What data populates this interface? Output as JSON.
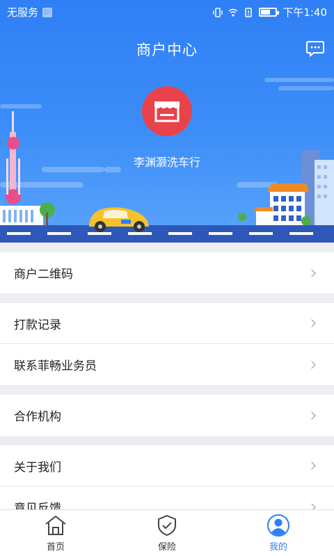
{
  "status_bar": {
    "carrier": "无服务",
    "time": "下午1:40"
  },
  "header": {
    "title": "商户中心",
    "message_icon": "chat-bubble-icon"
  },
  "merchant": {
    "name": "李渊灏洗车行",
    "avatar_icon": "storefront-icon",
    "avatar_color": "#e8434b"
  },
  "menu_groups": [
    [
      {
        "label": "商户二维码"
      }
    ],
    [
      {
        "label": "打款记录"
      },
      {
        "label": "联系菲畅业务员"
      }
    ],
    [
      {
        "label": "合作机构"
      }
    ],
    [
      {
        "label": "关于我们"
      },
      {
        "label": "意见反馈"
      }
    ]
  ],
  "tabs": [
    {
      "label": "首页",
      "icon": "home-icon",
      "active": false
    },
    {
      "label": "保险",
      "icon": "shield-check-icon",
      "active": false
    },
    {
      "label": "我的",
      "icon": "user-icon",
      "active": true
    }
  ],
  "colors": {
    "brand_blue": "#2f7ff6",
    "background": "#eeeef2"
  }
}
